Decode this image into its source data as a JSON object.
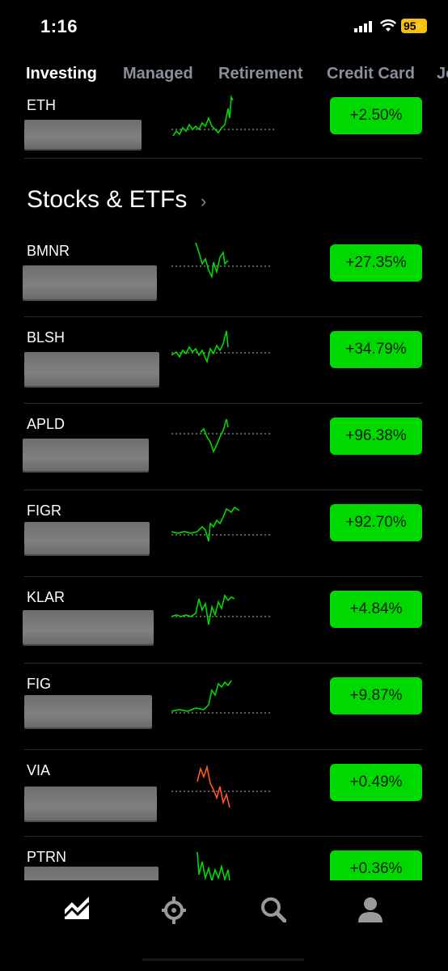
{
  "status": {
    "time": "1:16",
    "battery": "95"
  },
  "tabs": [
    "Investing",
    "Managed",
    "Retirement",
    "Credit Card",
    "Jo"
  ],
  "crypto": {
    "symbol": "ETH",
    "change": "+2.50%"
  },
  "section": {
    "title": "Stocks & ETFs",
    "chevron": "›"
  },
  "stocks": [
    {
      "symbol": "BMNR",
      "change": "+27.35%",
      "trend": "up"
    },
    {
      "symbol": "BLSH",
      "change": "+34.79%",
      "trend": "up"
    },
    {
      "symbol": "APLD",
      "change": "+96.38%",
      "trend": "up"
    },
    {
      "symbol": "FIGR",
      "change": "+92.70%",
      "trend": "up"
    },
    {
      "symbol": "KLAR",
      "change": "+4.84%",
      "trend": "up"
    },
    {
      "symbol": "FIG",
      "change": "+9.87%",
      "trend": "up"
    },
    {
      "symbol": "VIA",
      "change": "+0.49%",
      "trend": "down"
    },
    {
      "symbol": "PTRN",
      "change": "+0.36%",
      "trend": "up"
    }
  ],
  "colors": {
    "up": "#00d900",
    "down": "#ff5a1f",
    "pill": "#00d900"
  },
  "nav": [
    "investing-icon",
    "crypto-icon",
    "search-icon",
    "account-icon"
  ]
}
